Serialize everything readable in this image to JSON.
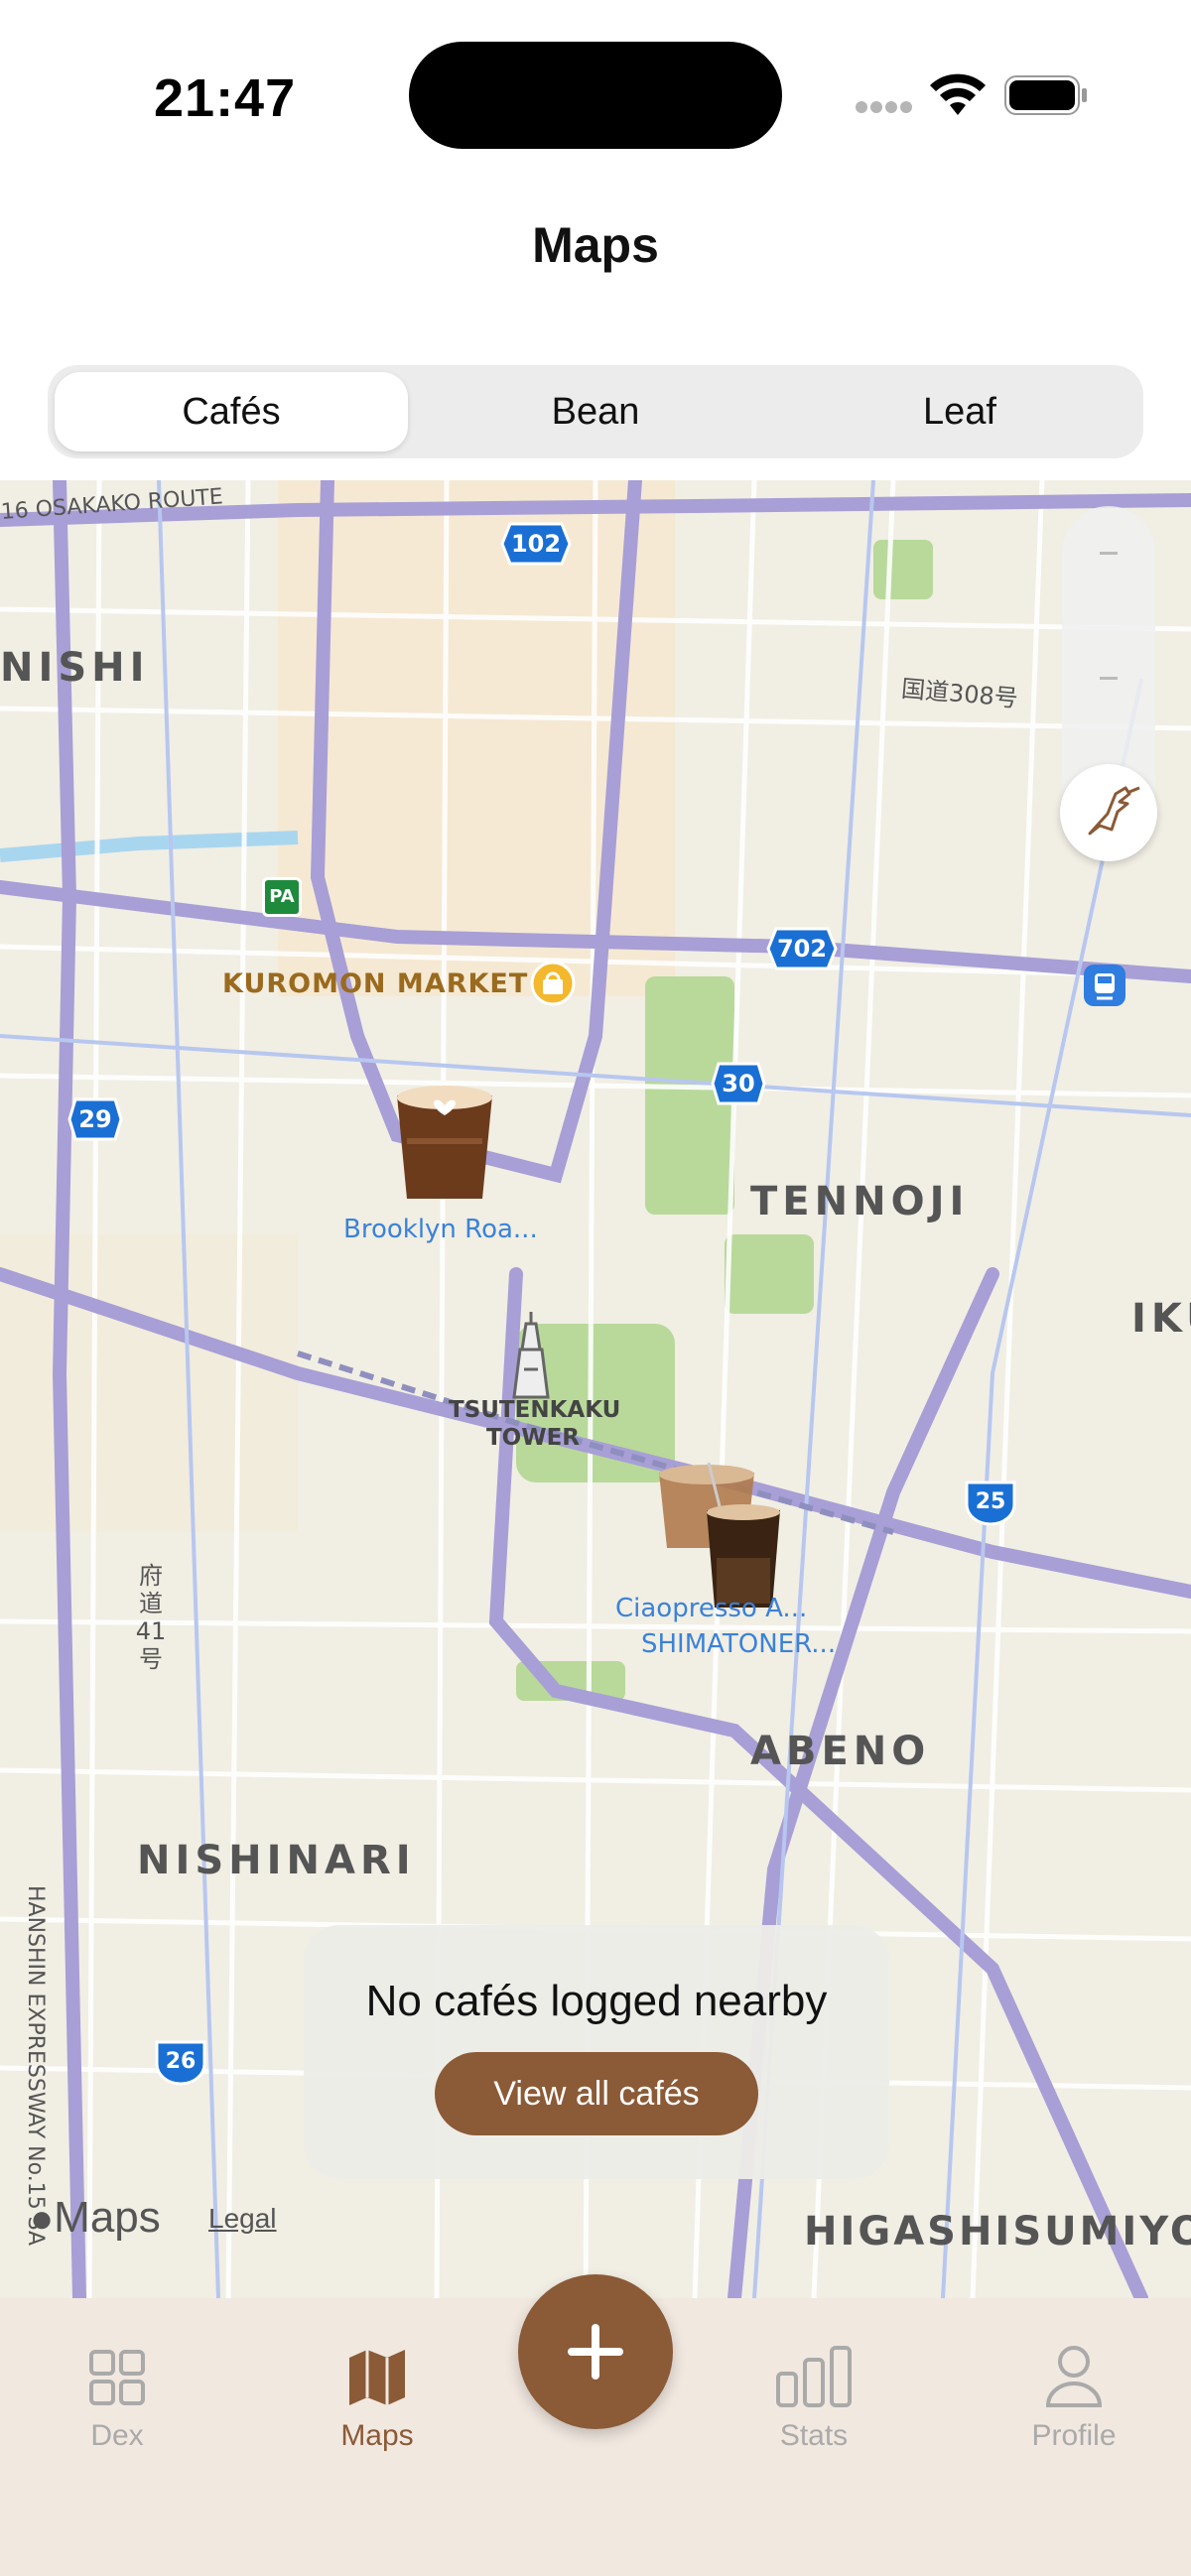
{
  "status": {
    "time": "21:47"
  },
  "nav": {
    "title": "Maps"
  },
  "segments": [
    {
      "label": "Cafés",
      "selected": true
    },
    {
      "label": "Bean",
      "selected": false
    },
    {
      "label": "Leaf",
      "selected": false
    }
  ],
  "map": {
    "labels": {
      "route16": "16 OSAKAKO ROUTE",
      "nishi": "NISHI",
      "kokudo308": "国道308号",
      "kuromon": "KUROMON MARKET",
      "tennoji": "TENNOJI",
      "iku": "IKU",
      "tsutenkaku": "TSUTENKAKU",
      "tower": "TOWER",
      "fudo41": "府道41号",
      "abeno": "ABENO",
      "nishinari": "NISHINARI",
      "hanshin": "HANSHIN EXPRESSWAY No.15 SA",
      "higashisumiyoshi": "HIGASHISUMIYOS",
      "pa": "PA"
    },
    "route_shields": [
      "102",
      "702",
      "30",
      "29",
      "25",
      "26"
    ],
    "cafes": [
      {
        "name": "Brooklyn Roa..."
      },
      {
        "name": "Ciaopresso A..."
      },
      {
        "name": "SHIMATONER..."
      }
    ],
    "attribution": {
      "logo": "Maps",
      "legal": "Legal"
    }
  },
  "toast": {
    "message": "No cafés logged nearby",
    "button": "View all cafés"
  },
  "tabs": [
    {
      "label": "Dex",
      "icon": "grid-icon",
      "active": false
    },
    {
      "label": "Maps",
      "icon": "map-icon",
      "active": true
    },
    {
      "label": "Stats",
      "icon": "bar-chart-icon",
      "active": false
    },
    {
      "label": "Profile",
      "icon": "person-icon",
      "active": false
    }
  ],
  "fab": {
    "icon": "plus-icon"
  },
  "colors": {
    "accent": "#8b5a36",
    "tab_bar": "#f1e8e0",
    "map_bg": "#f1eee4",
    "route": "#a89fd6",
    "park": "#b8d99a",
    "water": "#a9d6ef"
  }
}
